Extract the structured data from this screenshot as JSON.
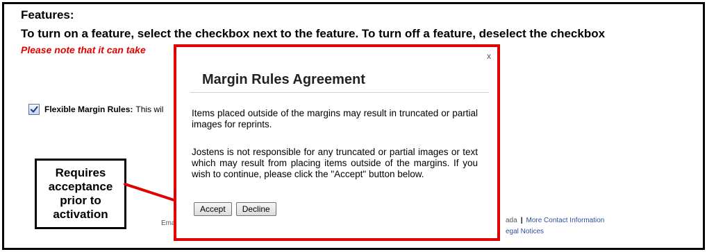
{
  "page": {
    "heading": "Features:",
    "instruction": "To turn on a feature, select the checkbox next to the feature. To turn off a feature, deselect the checkbox",
    "note": "Please note that it can take"
  },
  "feature": {
    "label": "Flexible Margin Rules:",
    "description": "This wil",
    "checked": true
  },
  "footer": {
    "left_text": "Ema",
    "right_text": "ada",
    "contact_link": "More Contact Information",
    "legal_link": "egal Notices"
  },
  "modal": {
    "close_label": "x",
    "title": "Margin Rules Agreement",
    "paragraph1": "Items placed outside of the margins may result in truncated or partial images for reprints.",
    "paragraph2": "Jostens is not responsible for any truncated or partial images or text which may result from placing items outside of the margins. If you wish to continue, please click the \"Accept\" button below.",
    "accept_label": "Accept",
    "decline_label": "Decline"
  },
  "callout": {
    "text": "Requires\nacceptance\nprior to\nactivation"
  },
  "colors": {
    "accent_red": "#e00000",
    "link_blue": "#2d4f9e",
    "checkbox_blue": "#1f3e8a"
  }
}
